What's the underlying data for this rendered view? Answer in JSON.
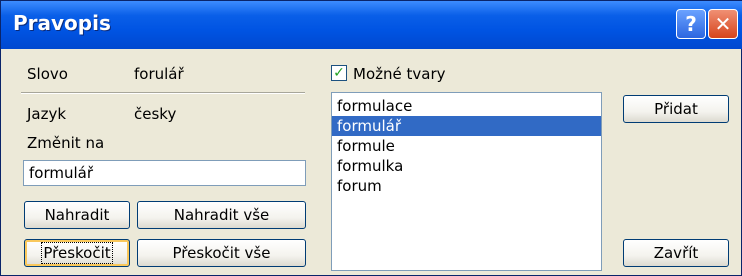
{
  "window": {
    "title": "Pravopis",
    "help_glyph": "?",
    "close_glyph": "✕"
  },
  "left": {
    "word_label": "Slovo",
    "word_value": "forulář",
    "language_label": "Jazyk",
    "language_value": "česky",
    "change_to_label": "Změnit na",
    "change_to_value": "formulář"
  },
  "buttons": {
    "replace": "Nahradit",
    "replace_all": "Nahradit vše",
    "skip": "Přeskočit",
    "skip_all": "Přeskočit vše",
    "add": "Přidat",
    "close": "Zavřít"
  },
  "suggestions": {
    "checkbox_label": "Možné tvary",
    "checked": true,
    "items": [
      "formulace",
      "formulář",
      "formule",
      "formulka",
      "forum"
    ],
    "selected_index": 1
  },
  "colors": {
    "title_bar": "#0054e3",
    "selection": "#316ac5",
    "dialog_bg": "#ece9d8"
  }
}
